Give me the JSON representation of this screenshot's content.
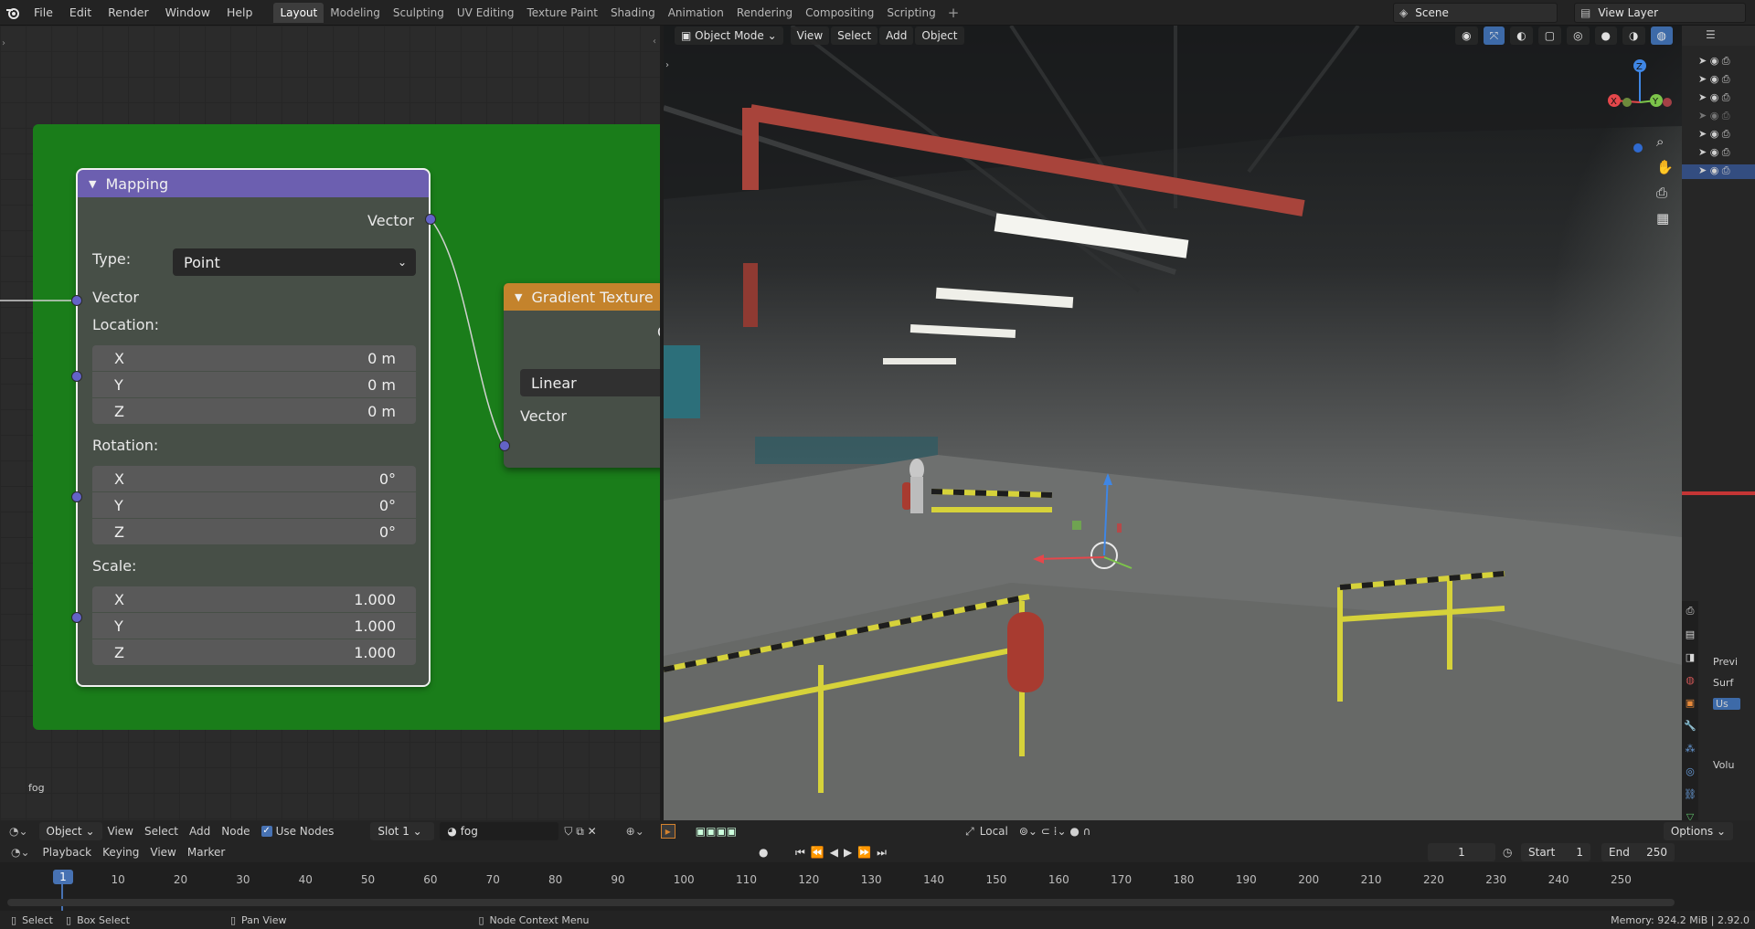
{
  "topbar": {
    "menus": [
      "File",
      "Edit",
      "Render",
      "Window",
      "Help"
    ],
    "workspaces": [
      "Layout",
      "Modeling",
      "Sculpting",
      "UV Editing",
      "Texture Paint",
      "Shading",
      "Animation",
      "Rendering",
      "Compositing",
      "Scripting"
    ],
    "active_workspace": "Layout",
    "scene": "Scene",
    "view_layer": "View Layer"
  },
  "node_editor": {
    "material_label": "fog",
    "mapping": {
      "title": "Mapping",
      "output_vector": "Vector",
      "type_label": "Type:",
      "type_value": "Point",
      "input_vector": "Vector",
      "location_label": "Location:",
      "location": [
        {
          "axis": "X",
          "value": "0 m"
        },
        {
          "axis": "Y",
          "value": "0 m"
        },
        {
          "axis": "Z",
          "value": "0 m"
        }
      ],
      "rotation_label": "Rotation:",
      "rotation": [
        {
          "axis": "X",
          "value": "0°"
        },
        {
          "axis": "Y",
          "value": "0°"
        },
        {
          "axis": "Z",
          "value": "0°"
        }
      ],
      "scale_label": "Scale:",
      "scale": [
        {
          "axis": "X",
          "value": "1.000"
        },
        {
          "axis": "Y",
          "value": "1.000"
        },
        {
          "axis": "Z",
          "value": "1.000"
        }
      ]
    },
    "gradient": {
      "title": "Gradient Texture",
      "type_value": "Linear",
      "input_vector": "Vector",
      "partial_output": "C"
    },
    "header": {
      "editor_type": "Object",
      "menus": [
        "View",
        "Select",
        "Add",
        "Node"
      ],
      "use_nodes_label": "Use Nodes",
      "slot": "Slot 1",
      "material": "fog"
    }
  },
  "viewport": {
    "mode": "Object Mode",
    "menus": [
      "View",
      "Select",
      "Add",
      "Object"
    ],
    "transform_orientation": "Local",
    "options_label": "Options",
    "gizmo_axes": [
      "Z",
      "X",
      "Y"
    ]
  },
  "timeline": {
    "menus": [
      "Playback",
      "Keying",
      "View",
      "Marker"
    ],
    "current_frame": "1",
    "start_label": "Start",
    "start": "1",
    "end_label": "End",
    "end": "250",
    "ticks": [
      "1",
      "10",
      "20",
      "30",
      "40",
      "50",
      "60",
      "70",
      "80",
      "90",
      "100",
      "110",
      "120",
      "130",
      "140",
      "150",
      "160",
      "170",
      "180",
      "190",
      "200",
      "210",
      "220",
      "230",
      "240",
      "250"
    ]
  },
  "right_panel": {
    "partial_labels": [
      "Previ",
      "Surf",
      "Us",
      "Volu"
    ]
  },
  "status": {
    "select": "Select",
    "box_select": "Box Select",
    "pan_view": "Pan View",
    "context_menu": "Node Context Menu",
    "memory": "Memory: 924.2 MiB | 2.92.0"
  },
  "colors": {
    "frame_green": "#1a7d1a",
    "mapping_header": "#6c5fb0",
    "gradient_header": "#c4832c",
    "socket_vector": "#6363c7"
  }
}
